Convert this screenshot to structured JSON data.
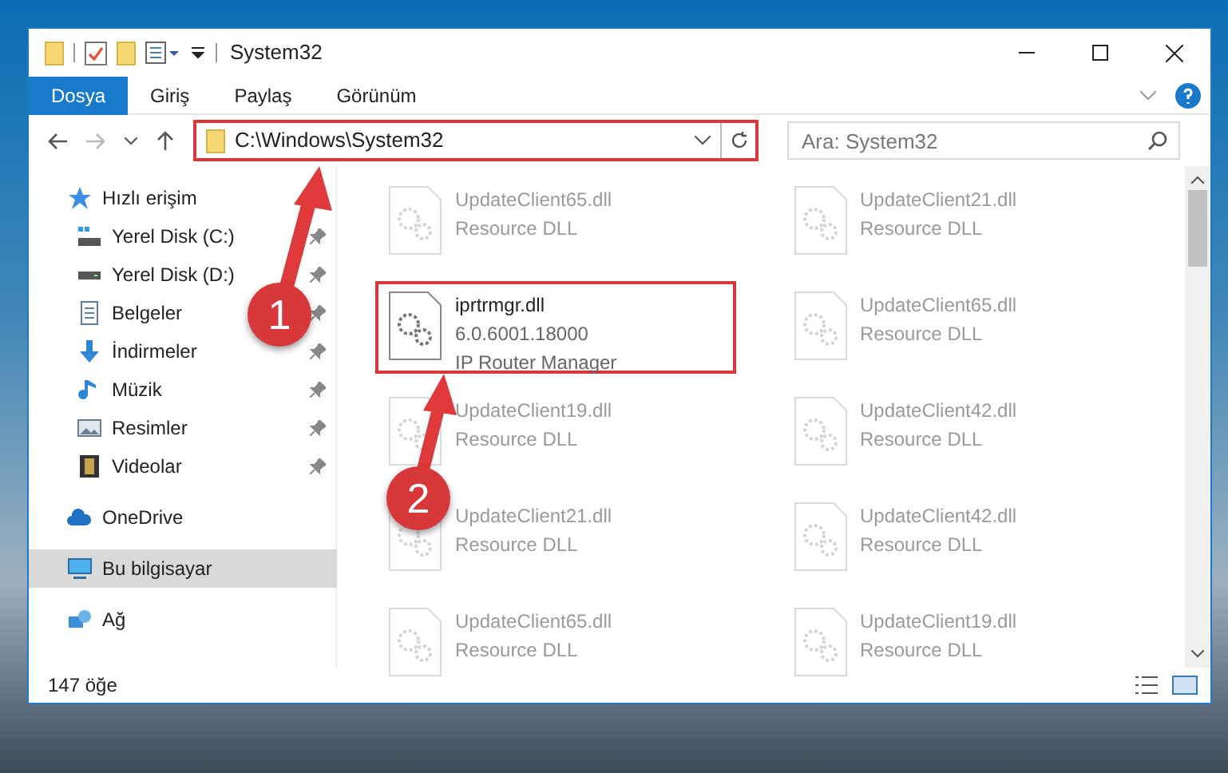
{
  "window": {
    "title": "System32"
  },
  "ribbon_tabs": [
    {
      "label": "Dosya",
      "selected": true
    },
    {
      "label": "Giriş",
      "selected": false
    },
    {
      "label": "Paylaş",
      "selected": false
    },
    {
      "label": "Görünüm",
      "selected": false
    }
  ],
  "address": {
    "path": "C:\\Windows\\System32",
    "highlighted": true
  },
  "search": {
    "placeholder": "Ara: System32"
  },
  "sidebar": {
    "items": [
      {
        "label": "Hızlı erişim",
        "kind": "star",
        "selected": false,
        "children": [
          {
            "label": "Yerel Disk (C:)",
            "kind": "drive-c",
            "pinned": true
          },
          {
            "label": "Yerel Disk (D:)",
            "kind": "drive",
            "pinned": true
          },
          {
            "label": "Belgeler",
            "kind": "documents",
            "pinned": true
          },
          {
            "label": "İndirmeler",
            "kind": "downloads",
            "pinned": true
          },
          {
            "label": "Müzik",
            "kind": "music",
            "pinned": true
          },
          {
            "label": "Resimler",
            "kind": "pictures",
            "pinned": true
          },
          {
            "label": "Videolar",
            "kind": "videos",
            "pinned": true
          }
        ]
      },
      {
        "label": "OneDrive",
        "kind": "cloud",
        "selected": false
      },
      {
        "label": "Bu bilgisayar",
        "kind": "computer",
        "selected": true
      },
      {
        "label": "Ağ",
        "kind": "network",
        "selected": false
      }
    ]
  },
  "files": [
    {
      "name": "UpdateClient65.dll",
      "lines": [
        "Resource DLL"
      ],
      "highlighted": false
    },
    {
      "name": "UpdateClient21.dll",
      "lines": [
        "Resource DLL"
      ],
      "highlighted": false
    },
    {
      "name": "iprtrmgr.dll",
      "lines": [
        "6.0.6001.18000",
        "IP Router Manager"
      ],
      "highlighted": true
    },
    {
      "name": "UpdateClient65.dll",
      "lines": [
        "Resource DLL"
      ],
      "highlighted": false
    },
    {
      "name": "UpdateClient19.dll",
      "lines": [
        "Resource DLL"
      ],
      "highlighted": false
    },
    {
      "name": "UpdateClient42.dll",
      "lines": [
        "Resource DLL"
      ],
      "highlighted": false
    },
    {
      "name": "UpdateClient21.dll",
      "lines": [
        "Resource DLL"
      ],
      "highlighted": false
    },
    {
      "name": "UpdateClient42.dll",
      "lines": [
        "Resource DLL"
      ],
      "highlighted": false
    },
    {
      "name": "UpdateClient65.dll",
      "lines": [
        "Resource DLL"
      ],
      "highlighted": false
    },
    {
      "name": "UpdateClient19.dll",
      "lines": [
        "Resource DLL"
      ],
      "highlighted": false
    }
  ],
  "annotations": [
    {
      "label": "1"
    },
    {
      "label": "2"
    }
  ],
  "status_bar": {
    "count": "147 öğe"
  }
}
